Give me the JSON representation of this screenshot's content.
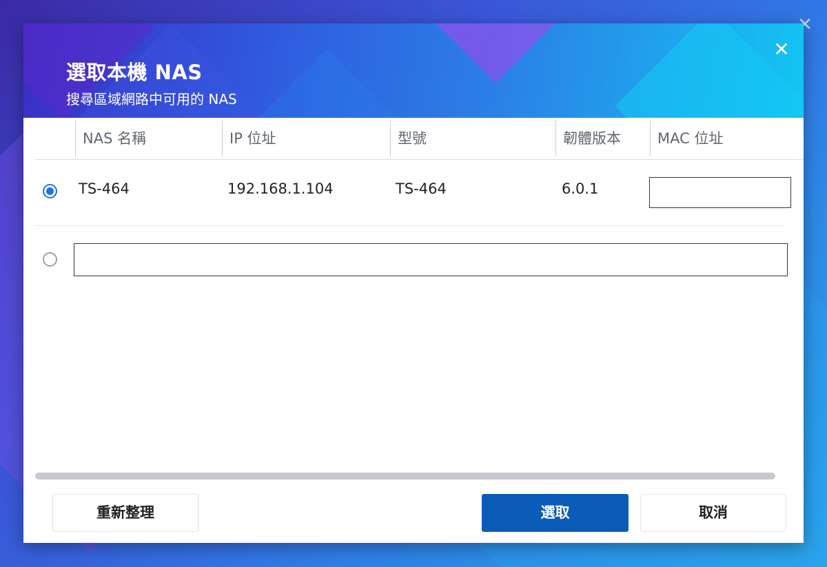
{
  "dialog": {
    "title": "選取本機 NAS",
    "subtitle": "搜尋區域網路中可用的 NAS",
    "close_icon": "close-icon"
  },
  "table": {
    "columns": [
      "NAS 名稱",
      "IP 位址",
      "型號",
      "韌體版本",
      "MAC 位址"
    ],
    "rows": [
      {
        "selected": true,
        "name": "TS-464",
        "ip": "192.168.1.104",
        "model": "TS-464",
        "firmware": "6.0.1",
        "mac": ""
      }
    ],
    "manual_entry": {
      "selected": false,
      "value": ""
    }
  },
  "buttons": {
    "refresh": "重新整理",
    "select": "選取",
    "cancel": "取消"
  },
  "colors": {
    "primary_button": "#0b5cb8",
    "radio_checked": "#1a73e8"
  }
}
